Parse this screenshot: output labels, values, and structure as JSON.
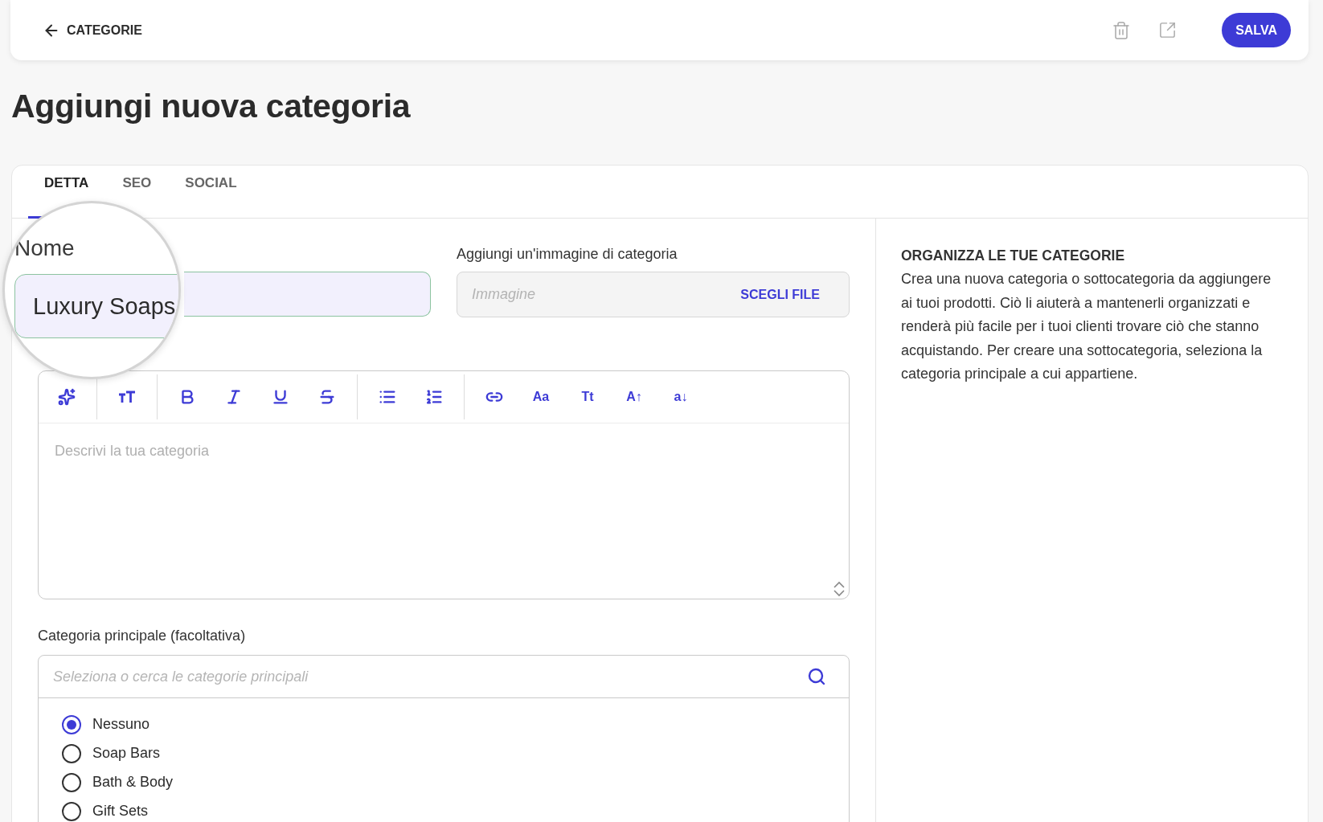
{
  "header": {
    "back_link": "CATEGORIE",
    "save_button": "SALVA"
  },
  "title": "Aggiungi nuova categoria",
  "tabs": [
    {
      "label": "DETTA",
      "selected": true
    },
    {
      "label": "SEO",
      "selected": false
    },
    {
      "label": "SOCIAL",
      "selected": false
    }
  ],
  "name_field": {
    "label": "Nome",
    "value": "Luxury Soaps"
  },
  "image_field": {
    "label": "Aggiungi un'immagine di categoria",
    "placeholder": "Immagine",
    "button": "SCEGLI FILE"
  },
  "editor": {
    "text_buttons": [
      "Aa",
      "Tt",
      "A↑",
      "a↓"
    ],
    "placeholder": "Descrivi la tua categoria"
  },
  "parent_category": {
    "label": "Categoria principale (facoltativa)",
    "placeholder": "Seleziona o cerca le categorie principali",
    "options": [
      {
        "label": "Nessuno",
        "selected": true
      },
      {
        "label": "Soap Bars",
        "selected": false
      },
      {
        "label": "Bath & Body",
        "selected": false
      },
      {
        "label": "Gift Sets",
        "selected": false
      }
    ]
  },
  "help": {
    "title": "ORGANIZZA LE TUE CATEGORIE",
    "text": "Crea una nuova categoria o sottocategoria da aggiungere ai tuoi prodotti. Ciò li aiuterà a mantenerli organizzati e renderà più facile per i tuoi clienti trovare ciò che stanno acquistando. Per creare una sottocategoria, seleziona la categoria principale a cui appartiene."
  }
}
